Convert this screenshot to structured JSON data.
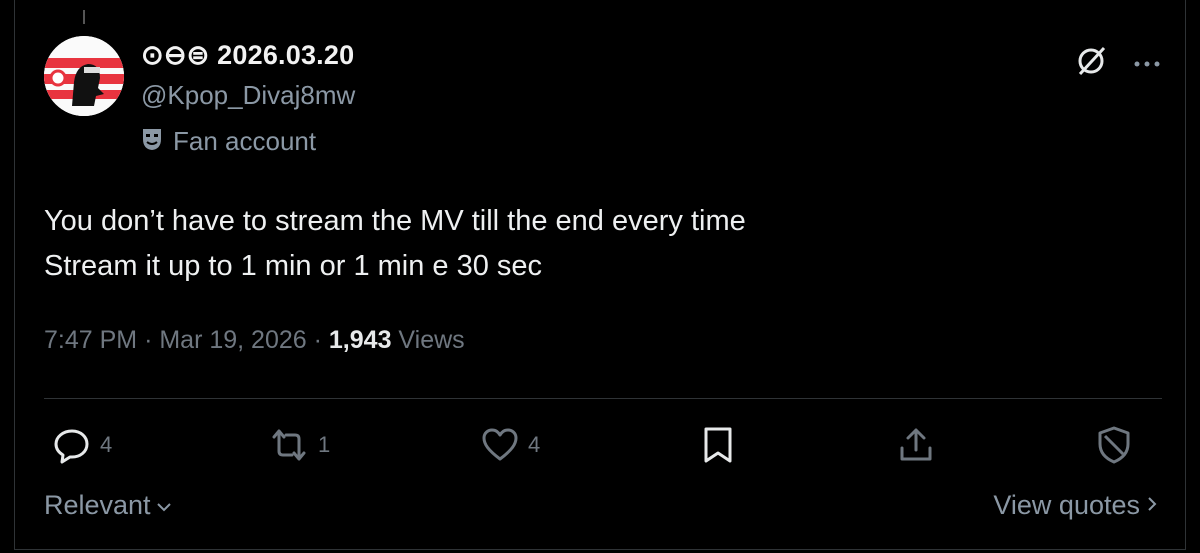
{
  "post": {
    "display_name": "⊙⊖⊜ 2026.03.20",
    "handle": "@Kpop_Divaj8mw",
    "account_label": "Fan account",
    "text_line1": "You don’t have to stream the MV till the end every time",
    "text_line2": "Stream it up to 1 min or 1 min e 30 sec",
    "time": "7:47 PM",
    "separator": "·",
    "date": "Mar 19, 2026",
    "views_count": "1,943",
    "views_label": "Views"
  },
  "actions": {
    "replies": "4",
    "reposts": "1",
    "likes": "4"
  },
  "footer": {
    "sort_label": "Relevant",
    "view_quotes_label": "View quotes"
  },
  "colors": {
    "background": "#000000",
    "text": "#e7e9ea",
    "muted": "#6f7780",
    "divider": "#2f3336"
  }
}
